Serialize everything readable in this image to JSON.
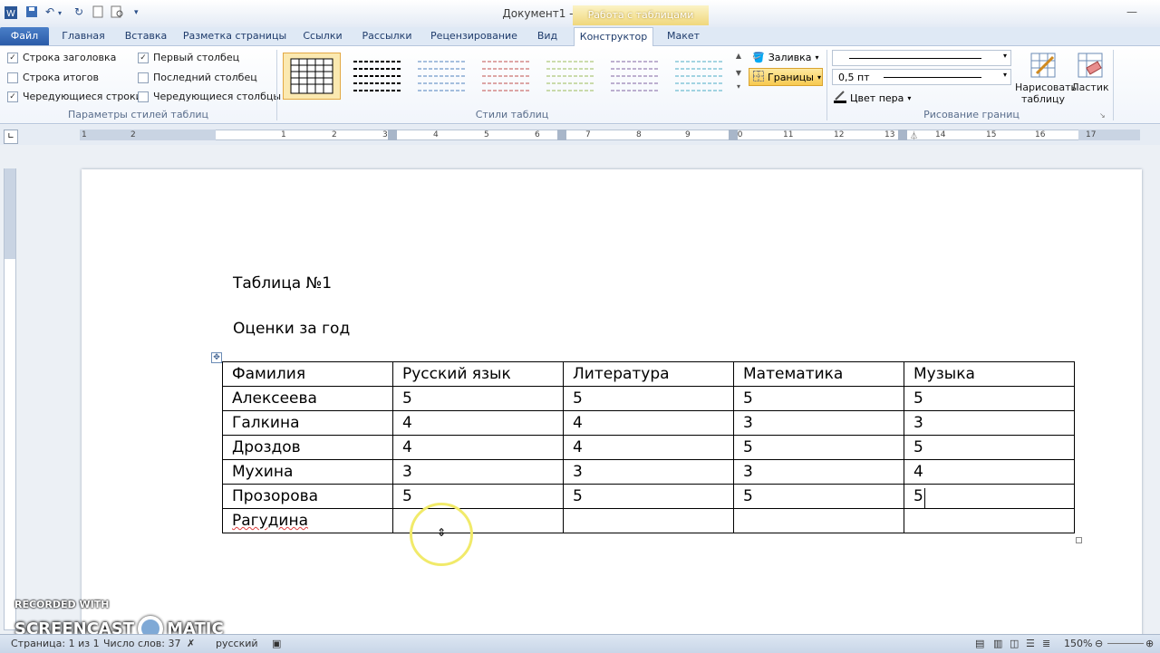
{
  "window": {
    "title": "Документ1 - Microsoft Word",
    "context_tab_group": "Работа с таблицами"
  },
  "tabs": [
    "Файл",
    "Главная",
    "Вставка",
    "Разметка страницы",
    "Ссылки",
    "Рассылки",
    "Рецензирование",
    "Вид",
    "Конструктор",
    "Макет"
  ],
  "active_tab": "Конструктор",
  "ribbon": {
    "table_style_options": {
      "label": "Параметры стилей таблиц",
      "options": [
        {
          "label": "Строка заголовка",
          "checked": true
        },
        {
          "label": "Первый столбец",
          "checked": true
        },
        {
          "label": "Строка итогов",
          "checked": false
        },
        {
          "label": "Последний столбец",
          "checked": false
        },
        {
          "label": "Чередующиеся строки",
          "checked": true
        },
        {
          "label": "Чередующиеся столбцы",
          "checked": false
        }
      ]
    },
    "table_styles": {
      "label": "Стили таблиц",
      "style_colors": [
        "#000000",
        "#000000",
        "#4f81bd",
        "#c0504d",
        "#9bbb59",
        "#8064a2",
        "#4bacc6"
      ]
    },
    "shading": {
      "label": "Заливка"
    },
    "borders": {
      "label": "Границы"
    },
    "draw_borders": {
      "label": "Рисование границ",
      "pen_weight": "0,5 пт",
      "pen_color_label": "Цвет пера",
      "draw_table_label": "Нарисовать таблицу",
      "eraser_label": "Ластик"
    }
  },
  "ruler": {
    "h_numbers": [
      "1",
      "2",
      "1",
      "2",
      "3",
      "4",
      "5",
      "6",
      "7",
      "8",
      "9",
      "10",
      "11",
      "12",
      "13",
      "14",
      "15",
      "16",
      "17"
    ]
  },
  "document": {
    "heading1": "Таблица №1",
    "heading2": "Оценки за год",
    "table": {
      "header": [
        "Фамилия",
        "Русский язык",
        "Литература",
        "Математика",
        "Музыка"
      ],
      "rows": [
        [
          "Алексеева",
          "5",
          "5",
          "5",
          "5"
        ],
        [
          "Галкина",
          "4",
          "4",
          "3",
          "3"
        ],
        [
          "Дроздов",
          "4",
          "4",
          "5",
          "5"
        ],
        [
          "Мухина",
          "3",
          "3",
          "3",
          "4"
        ],
        [
          "Прозорова",
          "5",
          "5",
          "5",
          "5"
        ],
        [
          "Рагудина",
          "",
          "",
          "",
          ""
        ]
      ]
    }
  },
  "statusbar": {
    "page": "Страница: 1 из 1",
    "words": "Число слов: 37",
    "language": "русский",
    "zoom": "150%"
  },
  "watermark": {
    "line1": "RECORDED WITH",
    "line2a": "SCREENCAST",
    "line2b": "MATIC"
  }
}
